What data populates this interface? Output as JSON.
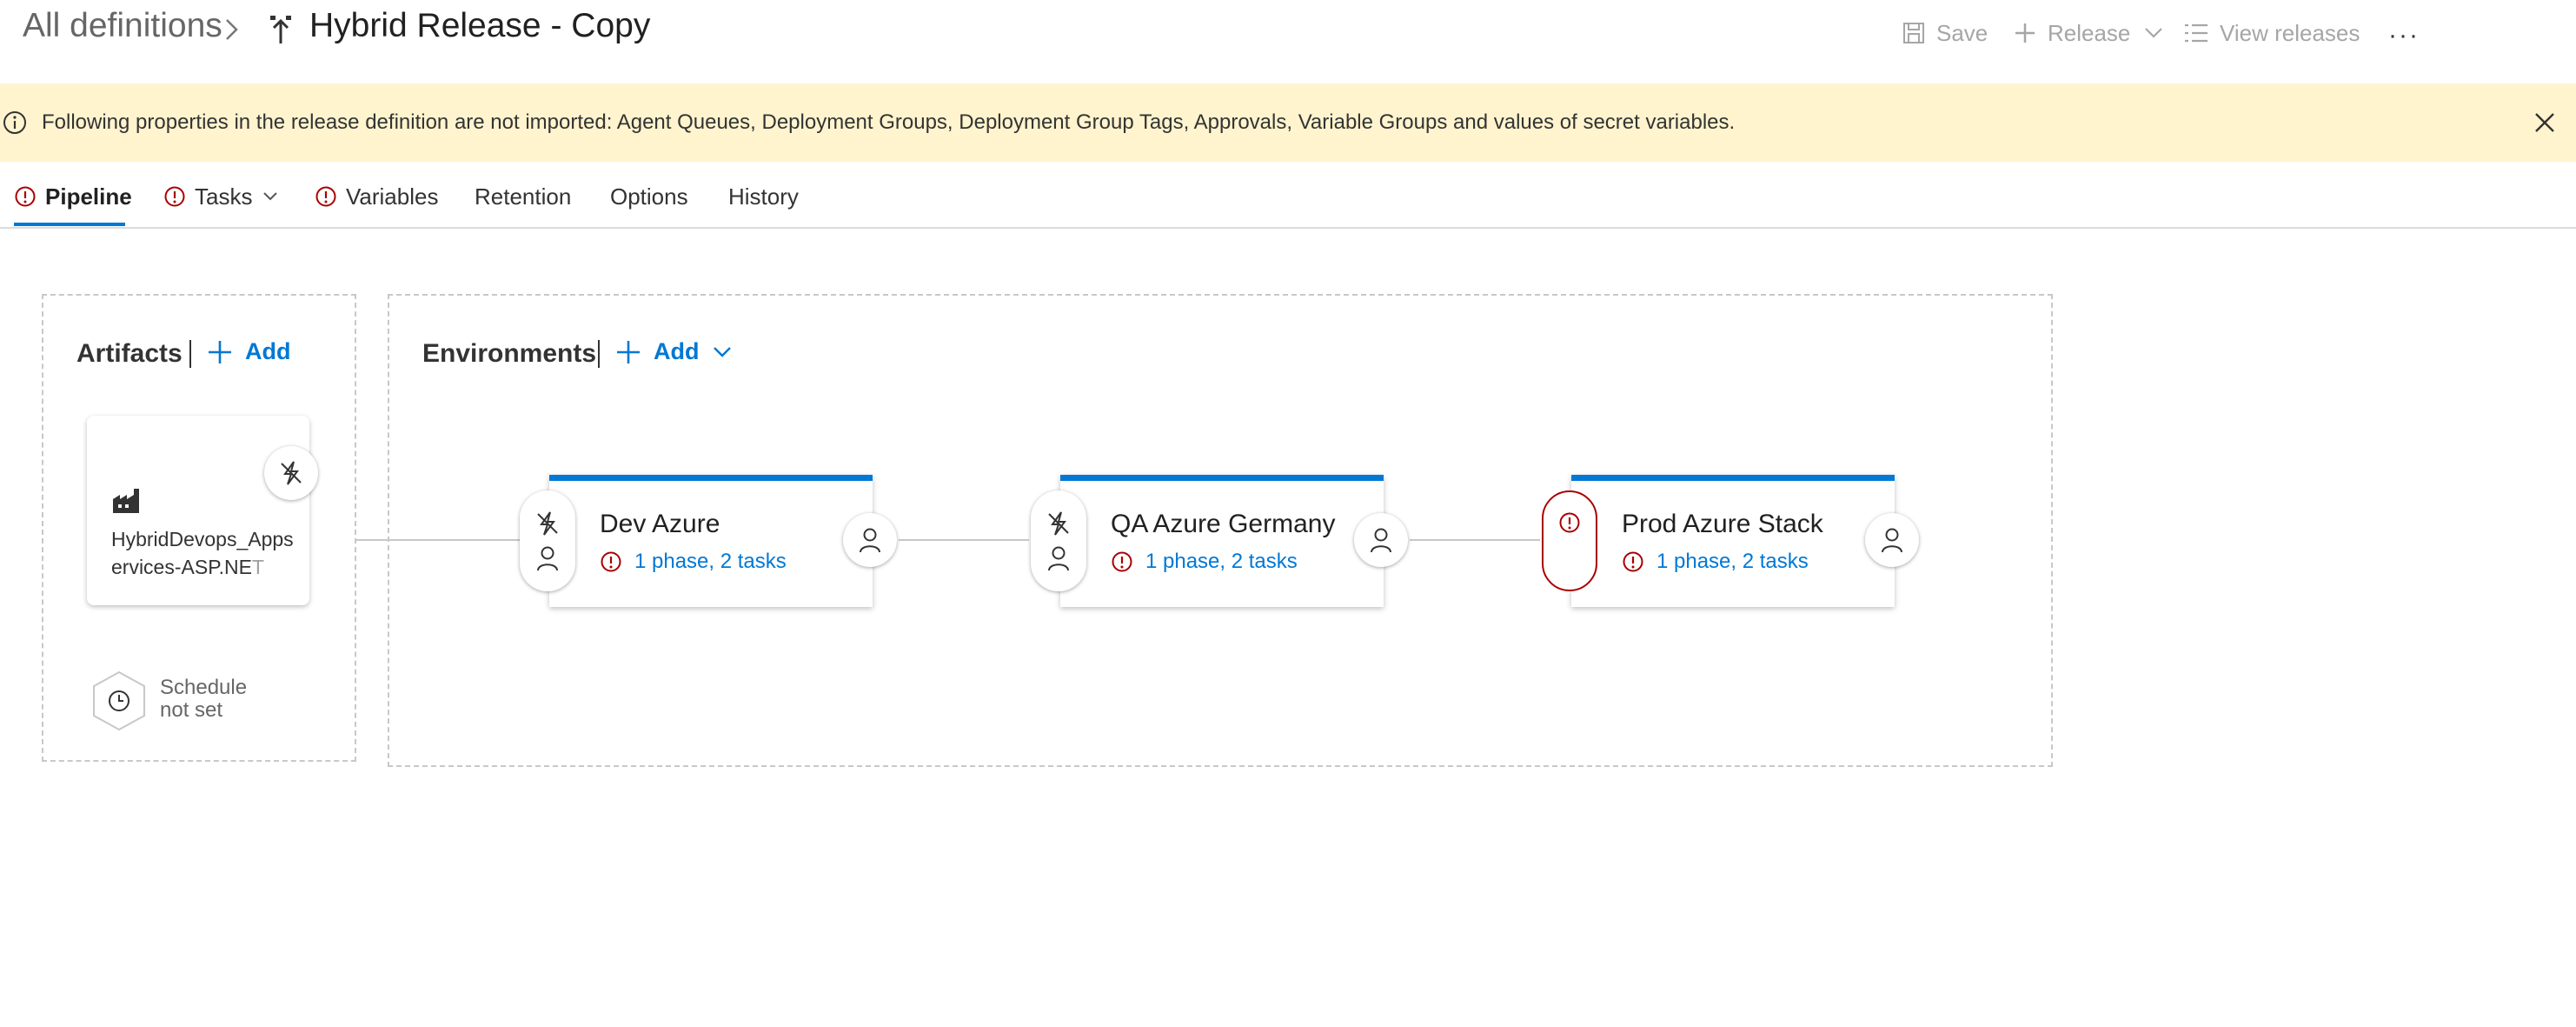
{
  "header": {
    "breadcrumb_root": "All definitions",
    "definition_title": "Hybrid Release - Copy"
  },
  "toolbar": {
    "save_label": "Save",
    "release_label": "Release",
    "view_releases_label": "View releases",
    "more_label": "···"
  },
  "banner": {
    "message": "Following properties in the release definition are not imported: Agent Queues, Deployment Groups, Deployment Group Tags, Approvals, Variable Groups and values of secret variables."
  },
  "tabs": [
    {
      "label": "Pipeline",
      "has_error": true,
      "active": true
    },
    {
      "label": "Tasks",
      "has_error": true,
      "has_dropdown": true
    },
    {
      "label": "Variables",
      "has_error": true
    },
    {
      "label": "Retention"
    },
    {
      "label": "Options"
    },
    {
      "label": "History"
    }
  ],
  "artifacts": {
    "title": "Artifacts",
    "add_label": "Add",
    "items": [
      {
        "name_main": "HybridDevops_Appservices-ASP.NE",
        "name_faded": "T",
        "icon": "build-artifact-icon"
      }
    ],
    "schedule_line1": "Schedule",
    "schedule_line2": "not set"
  },
  "environments": {
    "title": "Environments",
    "add_label": "Add",
    "items": [
      {
        "name": "Dev Azure",
        "summary": "1 phase, 2 tasks"
      },
      {
        "name": "QA Azure Germany",
        "summary": "1 phase, 2 tasks"
      },
      {
        "name": "Prod Azure Stack",
        "summary": "1 phase, 2 tasks"
      }
    ]
  },
  "colors": {
    "accent": "#0078d4",
    "error": "#a80000",
    "banner_bg": "#fff4ce"
  }
}
